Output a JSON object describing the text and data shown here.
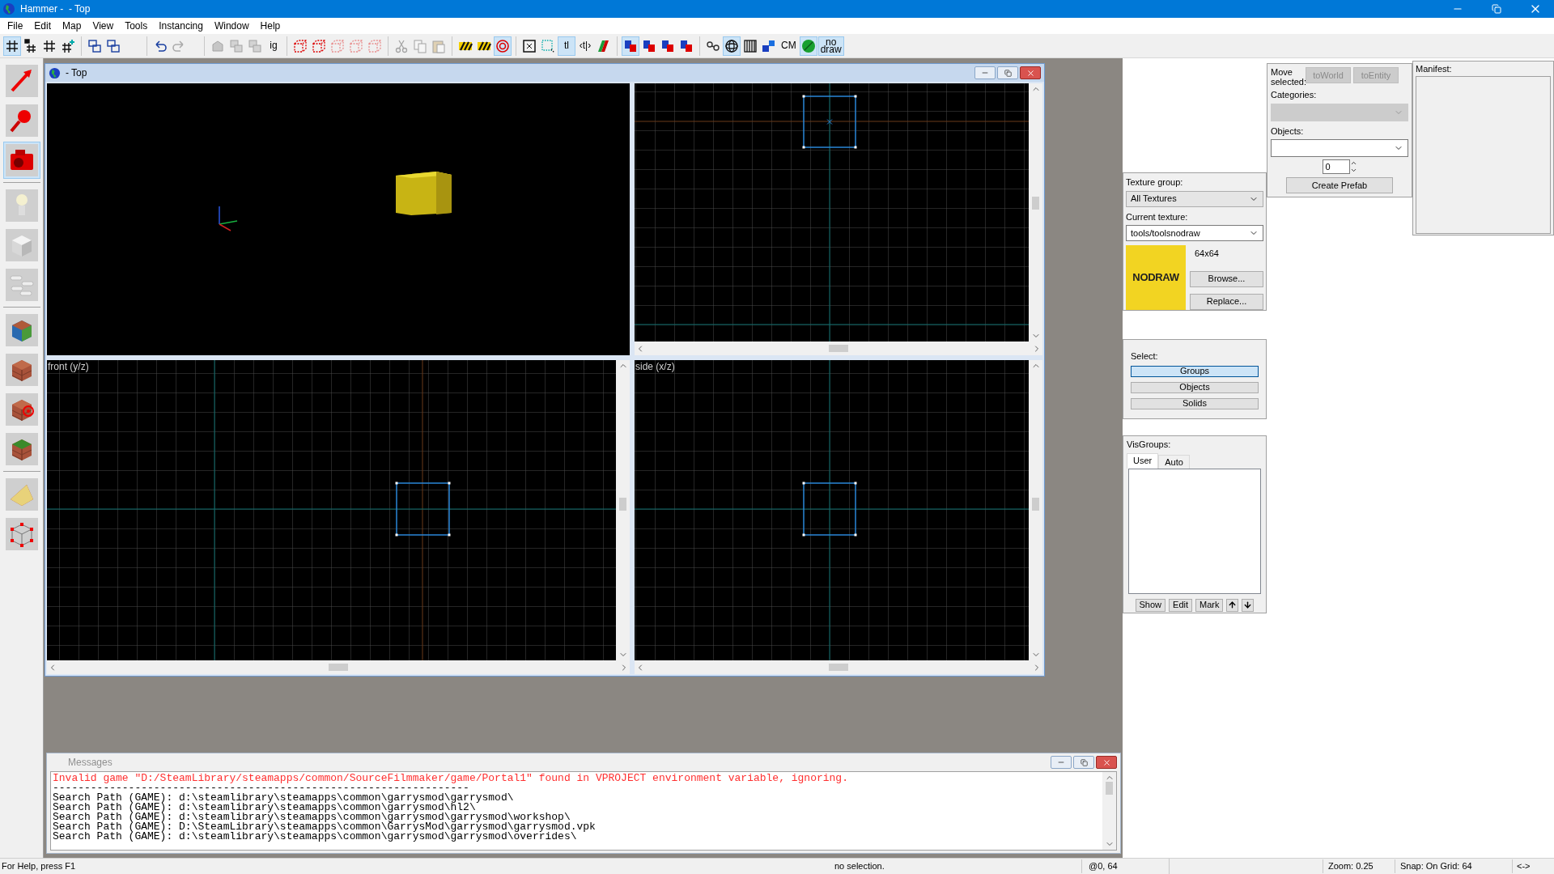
{
  "window": {
    "title": "Hammer -  - Top"
  },
  "menu": [
    "File",
    "Edit",
    "Map",
    "View",
    "Tools",
    "Instancing",
    "Window",
    "Help"
  ],
  "toolbar": {
    "groups": [
      {
        "items": [
          {
            "kind": "grid",
            "selected": true,
            "disabled": false
          },
          {
            "kind": "grid3d",
            "selected": false,
            "disabled": false
          },
          {
            "kind": "grid",
            "selected": false,
            "disabled": false
          },
          {
            "kind": "gridplus",
            "selected": false,
            "disabled": false
          }
        ]
      },
      {
        "items": [
          {
            "kind": "group",
            "selected": false,
            "disabled": false
          },
          {
            "kind": "group",
            "selected": false,
            "disabled": false
          }
        ]
      },
      {
        "items": [
          {
            "kind": "undo",
            "selected": false,
            "disabled": false
          },
          {
            "kind": "redo",
            "selected": false,
            "disabled": true
          }
        ]
      },
      {
        "items": [
          {
            "kind": "box",
            "selected": false,
            "disabled": true
          },
          {
            "kind": "stack",
            "selected": false,
            "disabled": true
          },
          {
            "kind": "stack",
            "selected": false,
            "disabled": true
          },
          {
            "kind": "text",
            "label": "ig",
            "selected": false,
            "disabled": false
          }
        ]
      },
      {
        "items": [
          {
            "kind": "dashcube",
            "selected": false,
            "disabled": false
          },
          {
            "kind": "dashcube",
            "selected": false,
            "disabled": false
          },
          {
            "kind": "dashcube",
            "selected": false,
            "disabled": true
          },
          {
            "kind": "dashcube",
            "selected": false,
            "disabled": true
          },
          {
            "kind": "dashcube",
            "selected": false,
            "disabled": true
          }
        ]
      },
      {
        "items": [
          {
            "kind": "scissors",
            "selected": false,
            "disabled": true
          },
          {
            "kind": "copy",
            "selected": false,
            "disabled": true
          },
          {
            "kind": "paste",
            "selected": false,
            "disabled": true
          }
        ]
      },
      {
        "items": [
          {
            "kind": "stripes",
            "selected": false,
            "disabled": false
          },
          {
            "kind": "stripes",
            "selected": false,
            "disabled": false
          },
          {
            "kind": "ring",
            "selected": true,
            "disabled": false
          }
        ]
      },
      {
        "items": [
          {
            "kind": "square",
            "selected": false,
            "disabled": false
          },
          {
            "kind": "dotsquare",
            "selected": false,
            "disabled": false
          },
          {
            "kind": "text",
            "label": "tl",
            "selected": true,
            "disabled": false
          },
          {
            "kind": "text",
            "label": "‹t|›",
            "selected": false,
            "disabled": false
          },
          {
            "kind": "split",
            "selected": false,
            "disabled": false
          }
        ]
      },
      {
        "items": [
          {
            "kind": "texture",
            "selected": true,
            "disabled": false
          },
          {
            "kind": "texture",
            "selected": false,
            "disabled": false
          },
          {
            "kind": "texture",
            "selected": false,
            "disabled": false
          },
          {
            "kind": "texture",
            "selected": false,
            "disabled": false
          }
        ]
      },
      {
        "items": [
          {
            "kind": "link",
            "selected": false,
            "disabled": false
          },
          {
            "kind": "sphere",
            "selected": true,
            "disabled": false
          },
          {
            "kind": "pattern",
            "selected": false,
            "disabled": false
          },
          {
            "kind": "cubes",
            "selected": false,
            "disabled": false
          },
          {
            "kind": "text",
            "label": "CM",
            "selected": false,
            "disabled": false
          },
          {
            "kind": "leaf",
            "selected": true,
            "disabled": false
          },
          {
            "kind": "text",
            "label": "no draw",
            "selected": true,
            "disabled": false
          }
        ]
      }
    ]
  },
  "tools": [
    {
      "items": [
        {
          "kind": "arrow",
          "selected": false
        },
        {
          "kind": "magnifier",
          "selected": false
        },
        {
          "kind": "camera",
          "selected": true
        }
      ]
    },
    {
      "items": [
        {
          "kind": "bulb",
          "selected": false
        },
        {
          "kind": "cube",
          "selected": false
        },
        {
          "kind": "pills",
          "selected": false
        }
      ]
    },
    {
      "items": [
        {
          "kind": "textured",
          "selected": false
        },
        {
          "kind": "brick",
          "selected": false
        },
        {
          "kind": "target",
          "selected": false
        },
        {
          "kind": "grass",
          "selected": false
        }
      ]
    },
    {
      "items": [
        {
          "kind": "wedge",
          "selected": false
        },
        {
          "kind": "wireframe",
          "selected": false
        }
      ]
    }
  ],
  "map_window": {
    "title": "- Top",
    "viewports": [
      {
        "kind": "perspective"
      },
      {
        "kind": "top"
      },
      {
        "kind": "front",
        "label": "front (y/z)"
      },
      {
        "kind": "side",
        "label": "side (x/z)"
      }
    ]
  },
  "messages": {
    "title": "Messages",
    "lines": [
      {
        "kind": "error",
        "text": "Invalid game \"D:/SteamLibrary/steamapps/common/SourceFilmmaker/game/Portal1\" found in VPROJECT environment variable, ignoring."
      },
      {
        "kind": "info",
        "text": "------------------------------------------------------------------"
      },
      {
        "kind": "info",
        "text": "Search Path (GAME): d:\\steamlibrary\\steamapps\\common\\garrysmod\\garrysmod\\"
      },
      {
        "kind": "info",
        "text": "Search Path (GAME): d:\\steamlibrary\\steamapps\\common\\garrysmod\\hl2\\"
      },
      {
        "kind": "info",
        "text": "Search Path (GAME): d:\\steamlibrary\\steamapps\\common\\garrysmod\\garrysmod\\workshop\\"
      },
      {
        "kind": "info",
        "text": "Search Path (GAME): D:\\SteamLibrary\\steamapps\\common\\GarrysMod\\garrysmod\\garrysmod.vpk"
      },
      {
        "kind": "info",
        "text": "Search Path (GAME): d:\\steamlibrary\\steamapps\\common\\garrysmod\\garrysmod\\overrides\\"
      }
    ]
  },
  "prefab_panel": {
    "move_label": "Move selected:",
    "move_buttons": [
      {
        "label": "toWorld",
        "disabled": true
      },
      {
        "label": "toEntity",
        "disabled": true
      }
    ],
    "categories_label": "Categories:",
    "categories_disabled": true,
    "objects_label": "Objects:",
    "count": "0",
    "create_button": "Create Prefab"
  },
  "manifest": {
    "label": "Manifest:"
  },
  "texture_panel": {
    "group_label": "Texture group:",
    "group_value": "All Textures",
    "current_label": "Current texture:",
    "current_value": "tools/toolsnodraw",
    "preview_text": "NODRAW",
    "size": "64x64",
    "buttons": [
      "Browse...",
      "Replace..."
    ]
  },
  "select_panel": {
    "label": "Select:",
    "options": [
      {
        "label": "Groups",
        "selected": true
      },
      {
        "label": "Objects",
        "selected": false
      },
      {
        "label": "Solids",
        "selected": false
      }
    ]
  },
  "visgroups": {
    "label": "VisGroups:",
    "tabs": [
      {
        "label": "User",
        "selected": true
      },
      {
        "label": "Auto",
        "selected": false
      }
    ],
    "buttons": [
      {
        "kind": "text",
        "label": "Show"
      },
      {
        "kind": "text",
        "label": "Edit"
      },
      {
        "kind": "text",
        "label": "Mark"
      },
      {
        "kind": "up"
      },
      {
        "kind": "down"
      }
    ]
  },
  "status_bar": [
    "For Help, press F1",
    "no selection.",
    "@0, 64",
    "Zoom: 0.25",
    "Snap: On Grid: 64",
    "<->"
  ]
}
